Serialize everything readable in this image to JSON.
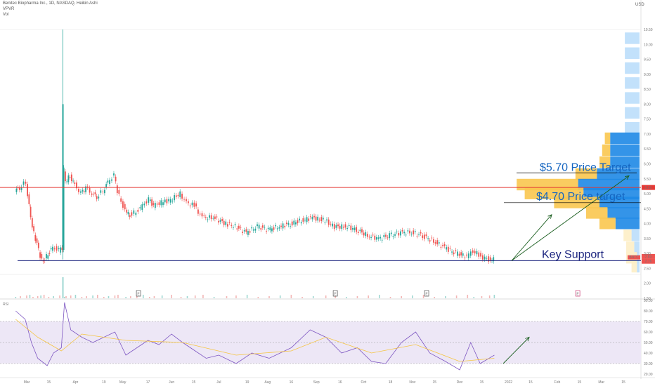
{
  "header": {
    "title": "Benitec Biopharma Inc., 1D, NASDAQ, Heikin Ashi",
    "indicator_1": "VPVR",
    "indicator_2": "Vol",
    "currency": "USD"
  },
  "colors": {
    "up": "#26a69a",
    "down": "#ef5350",
    "resistance": "#e53935",
    "support": "#1a237e",
    "arrow": "#1b5e20",
    "vp_up": "#1e88e5",
    "vp_up_light": "#bbdefb",
    "vp_down": "#f9c74f",
    "vp_down_light": "#fdeec6",
    "rsi_line": "#7e57c2",
    "rsi_ma": "#f5c542",
    "rsi_band": "#ede7f6"
  },
  "chart_data": [
    {
      "type": "candlestick",
      "y_ticks": [
        "10.50",
        "10.00",
        "9.50",
        "9.00",
        "8.50",
        "8.00",
        "7.50",
        "7.00",
        "6.50",
        "6.00",
        "5.50",
        "5.00",
        "4.50",
        "4.00",
        "3.50",
        "3.00",
        "2.50",
        "2.00",
        "1.50"
      ],
      "ylim": [
        1.5,
        10.5
      ],
      "x_ticks": [
        "Mar",
        "15",
        "Apr",
        "19",
        "May",
        "17",
        "Jun",
        "15",
        "Jul",
        "19",
        "Aug",
        "16",
        "Sep",
        "16",
        "Oct",
        "18",
        "Nov",
        "15",
        "Dec",
        "15",
        "2022",
        "15",
        "Feb",
        "15",
        "Mar",
        "15"
      ],
      "x_range": [
        "2021-03-01",
        "2022-03-23"
      ],
      "series": [
        {
          "date": "2021-02-22",
          "value": 5.1
        },
        {
          "date": "2021-02-25",
          "value": 5.2
        },
        {
          "date": "2021-03-01",
          "value": 5.4
        },
        {
          "date": "2021-03-03",
          "value": 4.6
        },
        {
          "date": "2021-03-05",
          "value": 3.9
        },
        {
          "date": "2021-03-08",
          "value": 3.3
        },
        {
          "date": "2021-03-10",
          "value": 2.9
        },
        {
          "date": "2021-03-12",
          "value": 2.7
        },
        {
          "date": "2021-03-15",
          "value": 3.0
        },
        {
          "date": "2021-03-18",
          "value": 3.2
        },
        {
          "date": "2021-03-22",
          "value": 3.1
        },
        {
          "date": "2021-03-24",
          "value": 3.2
        },
        {
          "date": "2021-03-25",
          "value": 5.8
        },
        {
          "date": "2021-03-26",
          "value": 5.4
        },
        {
          "date": "2021-03-29",
          "value": 5.6
        },
        {
          "date": "2021-04-01",
          "value": 5.3
        },
        {
          "date": "2021-04-05",
          "value": 5.0
        },
        {
          "date": "2021-04-08",
          "value": 5.2
        },
        {
          "date": "2021-04-12",
          "value": 5.0
        },
        {
          "date": "2021-04-15",
          "value": 4.9
        },
        {
          "date": "2021-04-19",
          "value": 5.1
        },
        {
          "date": "2021-04-22",
          "value": 5.4
        },
        {
          "date": "2021-04-26",
          "value": 5.6
        },
        {
          "date": "2021-04-28",
          "value": 5.1
        },
        {
          "date": "2021-05-03",
          "value": 4.4
        },
        {
          "date": "2021-05-06",
          "value": 4.3
        },
        {
          "date": "2021-05-10",
          "value": 4.4
        },
        {
          "date": "2021-05-14",
          "value": 4.6
        },
        {
          "date": "2021-05-18",
          "value": 4.8
        },
        {
          "date": "2021-05-21",
          "value": 4.6
        },
        {
          "date": "2021-05-26",
          "value": 4.7
        },
        {
          "date": "2021-06-01",
          "value": 4.8
        },
        {
          "date": "2021-06-07",
          "value": 5.0
        },
        {
          "date": "2021-06-11",
          "value": 4.7
        },
        {
          "date": "2021-06-16",
          "value": 4.6
        },
        {
          "date": "2021-06-21",
          "value": 4.2
        },
        {
          "date": "2021-06-28",
          "value": 4.2
        },
        {
          "date": "2021-07-06",
          "value": 4.0
        },
        {
          "date": "2021-07-12",
          "value": 3.9
        },
        {
          "date": "2021-07-19",
          "value": 3.7
        },
        {
          "date": "2021-07-26",
          "value": 3.9
        },
        {
          "date": "2021-08-02",
          "value": 3.8
        },
        {
          "date": "2021-08-09",
          "value": 3.9
        },
        {
          "date": "2021-08-16",
          "value": 4.0
        },
        {
          "date": "2021-08-23",
          "value": 4.1
        },
        {
          "date": "2021-08-30",
          "value": 4.2
        },
        {
          "date": "2021-09-07",
          "value": 4.1
        },
        {
          "date": "2021-09-13",
          "value": 3.9
        },
        {
          "date": "2021-09-20",
          "value": 3.9
        },
        {
          "date": "2021-09-27",
          "value": 3.8
        },
        {
          "date": "2021-10-04",
          "value": 3.6
        },
        {
          "date": "2021-10-11",
          "value": 3.5
        },
        {
          "date": "2021-10-18",
          "value": 3.6
        },
        {
          "date": "2021-10-25",
          "value": 3.7
        },
        {
          "date": "2021-11-01",
          "value": 3.7
        },
        {
          "date": "2021-11-08",
          "value": 3.6
        },
        {
          "date": "2021-11-15",
          "value": 3.4
        },
        {
          "date": "2021-11-22",
          "value": 3.2
        },
        {
          "date": "2021-11-29",
          "value": 3.0
        },
        {
          "date": "2021-12-06",
          "value": 2.9
        },
        {
          "date": "2021-12-10",
          "value": 3.1
        },
        {
          "date": "2021-12-15",
          "value": 2.9
        },
        {
          "date": "2021-12-20",
          "value": 2.8
        },
        {
          "date": "2021-12-23",
          "value": 2.8
        }
      ],
      "price_labels": {
        "resistance": "5.21",
        "last_a": "2.83",
        "last_b": "2.76",
        "ticker": "BNTC"
      },
      "levels": {
        "resistance": 5.21,
        "support": 2.76
      },
      "earnings_markers": [
        {
          "date": "2021-05-11",
          "label": "E"
        },
        {
          "date": "2021-09-13",
          "label": "E"
        },
        {
          "date": "2021-11-10",
          "label": "E"
        },
        {
          "date": "2022-02-14",
          "label": "E"
        }
      ],
      "annotations": [
        {
          "text": "$5.70 Price Target",
          "price": 5.7
        },
        {
          "text": "$4.70 Price target",
          "price": 4.7
        },
        {
          "text": "Key Support",
          "price": 2.76
        }
      ],
      "volume_profile": [
        {
          "price": 10.2,
          "up": 0.55,
          "down": 0.0
        },
        {
          "price": 9.7,
          "up": 0.55,
          "down": 0.0
        },
        {
          "price": 9.2,
          "up": 0.55,
          "down": 0.0
        },
        {
          "price": 8.7,
          "up": 0.55,
          "down": 0.0
        },
        {
          "price": 8.2,
          "up": 0.55,
          "down": 0.0
        },
        {
          "price": 7.7,
          "up": 0.55,
          "down": 0.0
        },
        {
          "price": 7.2,
          "up": 0.55,
          "down": 0.0
        },
        {
          "price": 6.85,
          "up": 1.1,
          "down": 0.2
        },
        {
          "price": 6.45,
          "up": 1.1,
          "down": 0.3
        },
        {
          "price": 6.05,
          "up": 1.1,
          "down": 0.4
        },
        {
          "price": 5.65,
          "up": 1.6,
          "down": 0.8
        },
        {
          "price": 5.3,
          "up": 2.3,
          "down": 2.3
        },
        {
          "price": 5.0,
          "up": 2.1,
          "down": 2.2
        },
        {
          "price": 4.7,
          "up": 1.5,
          "down": 1.7
        },
        {
          "price": 4.35,
          "up": 1.2,
          "down": 0.8
        },
        {
          "price": 4.0,
          "up": 0.9,
          "down": 0.6
        },
        {
          "price": 3.6,
          "up": 0.3,
          "down": 0.3
        },
        {
          "price": 3.2,
          "up": 0.2,
          "down": 0.3
        },
        {
          "price": 2.85,
          "up": 0.1,
          "down": 0.4
        },
        {
          "price": 2.55,
          "up": 0.1,
          "down": 0.2
        }
      ]
    },
    {
      "type": "line",
      "title": "RSI",
      "y_ticks": [
        "90.00",
        "80.00",
        "70.00",
        "60.00",
        "50.00",
        "40.00",
        "30.00",
        "20.00"
      ],
      "ylim": [
        18,
        90
      ],
      "bands": [
        70,
        50,
        30
      ],
      "series": [
        {
          "date": "2021-02-22",
          "value": 80
        },
        {
          "date": "2021-02-28",
          "value": 72
        },
        {
          "date": "2021-03-04",
          "value": 50
        },
        {
          "date": "2021-03-08",
          "value": 35
        },
        {
          "date": "2021-03-14",
          "value": 28
        },
        {
          "date": "2021-03-18",
          "value": 40
        },
        {
          "date": "2021-03-23",
          "value": 45
        },
        {
          "date": "2021-03-25",
          "value": 88
        },
        {
          "date": "2021-03-29",
          "value": 62
        },
        {
          "date": "2021-04-05",
          "value": 55
        },
        {
          "date": "2021-04-12",
          "value": 50
        },
        {
          "date": "2021-04-19",
          "value": 55
        },
        {
          "date": "2021-04-26",
          "value": 60
        },
        {
          "date": "2021-05-03",
          "value": 38
        },
        {
          "date": "2021-05-10",
          "value": 45
        },
        {
          "date": "2021-05-17",
          "value": 52
        },
        {
          "date": "2021-05-24",
          "value": 48
        },
        {
          "date": "2021-06-01",
          "value": 58
        },
        {
          "date": "2021-06-08",
          "value": 50
        },
        {
          "date": "2021-06-16",
          "value": 42
        },
        {
          "date": "2021-06-23",
          "value": 35
        },
        {
          "date": "2021-07-01",
          "value": 38
        },
        {
          "date": "2021-07-12",
          "value": 30
        },
        {
          "date": "2021-07-22",
          "value": 40
        },
        {
          "date": "2021-08-02",
          "value": 35
        },
        {
          "date": "2021-08-16",
          "value": 45
        },
        {
          "date": "2021-08-28",
          "value": 62
        },
        {
          "date": "2021-09-07",
          "value": 55
        },
        {
          "date": "2021-09-17",
          "value": 40
        },
        {
          "date": "2021-09-27",
          "value": 45
        },
        {
          "date": "2021-10-06",
          "value": 32
        },
        {
          "date": "2021-10-15",
          "value": 30
        },
        {
          "date": "2021-10-25",
          "value": 50
        },
        {
          "date": "2021-11-03",
          "value": 60
        },
        {
          "date": "2021-11-12",
          "value": 40
        },
        {
          "date": "2021-11-22",
          "value": 32
        },
        {
          "date": "2021-12-01",
          "value": 24
        },
        {
          "date": "2021-12-08",
          "value": 50
        },
        {
          "date": "2021-12-14",
          "value": 30
        },
        {
          "date": "2021-12-23",
          "value": 38
        }
      ],
      "ma_series": [
        {
          "date": "2021-02-22",
          "value": 72
        },
        {
          "date": "2021-03-08",
          "value": 55
        },
        {
          "date": "2021-03-23",
          "value": 42
        },
        {
          "date": "2021-04-05",
          "value": 58
        },
        {
          "date": "2021-05-03",
          "value": 52
        },
        {
          "date": "2021-06-08",
          "value": 50
        },
        {
          "date": "2021-07-12",
          "value": 38
        },
        {
          "date": "2021-08-16",
          "value": 42
        },
        {
          "date": "2021-09-07",
          "value": 55
        },
        {
          "date": "2021-10-06",
          "value": 40
        },
        {
          "date": "2021-11-03",
          "value": 48
        },
        {
          "date": "2021-12-01",
          "value": 32
        },
        {
          "date": "2021-12-23",
          "value": 35
        }
      ]
    }
  ]
}
